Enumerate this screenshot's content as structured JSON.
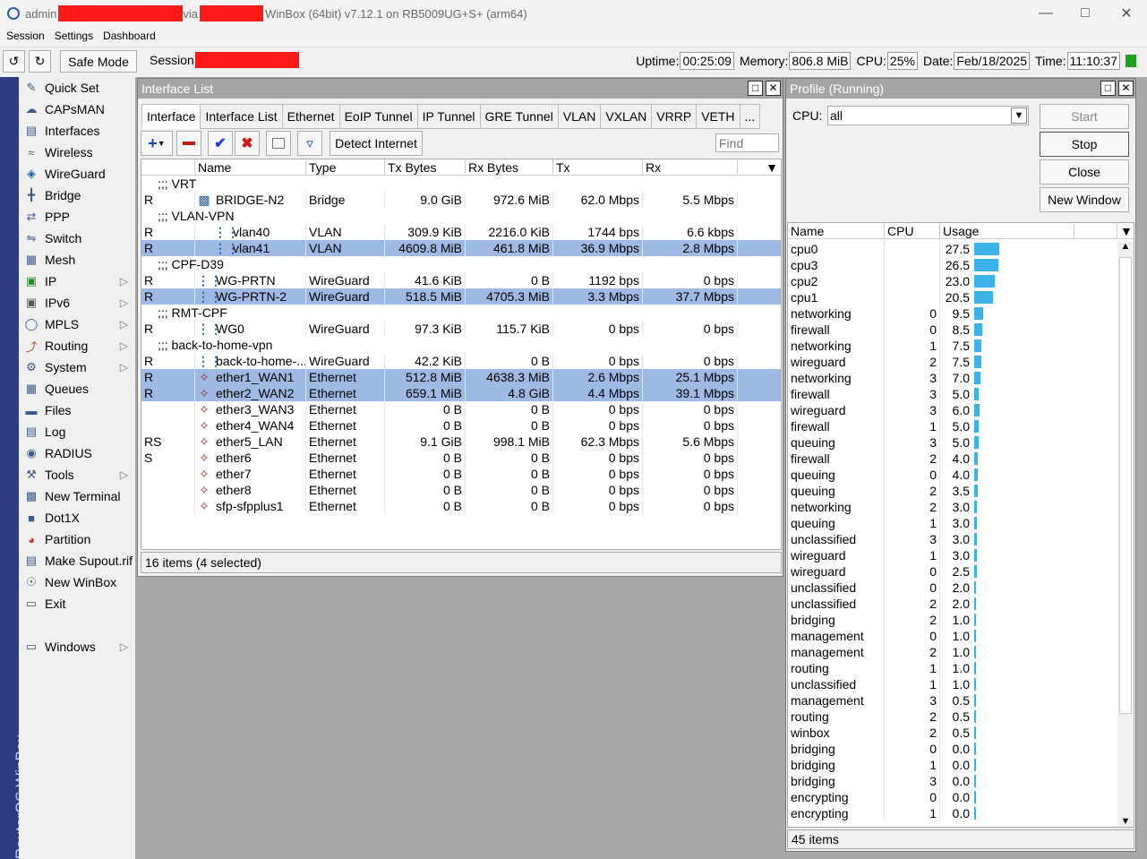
{
  "title": {
    "user": "admin",
    "via": "via",
    "app": "WinBox (64bit) v7.12.1 on RB5009UG+S+ (arm64)"
  },
  "menu": [
    "Session",
    "Settings",
    "Dashboard"
  ],
  "toolbar": {
    "safe_mode": "Safe Mode",
    "session_label": "Session:"
  },
  "status": {
    "uptime_label": "Uptime:",
    "uptime": "00:25:09",
    "memory_label": "Memory:",
    "memory": "806.8 MiB",
    "cpu_label": "CPU:",
    "cpu": "25%",
    "date_label": "Date:",
    "date": "Feb/18/2025",
    "time_label": "Time:",
    "time": "11:10:37"
  },
  "brand": "RouterOS WinBox",
  "sidebar": [
    {
      "label": "Quick Set",
      "icon": "wand-icon",
      "arrow": false
    },
    {
      "label": "CAPsMAN",
      "icon": "caps-icon",
      "arrow": false
    },
    {
      "label": "Interfaces",
      "icon": "interfaces-icon",
      "arrow": false
    },
    {
      "label": "Wireless",
      "icon": "wireless-icon",
      "arrow": false
    },
    {
      "label": "WireGuard",
      "icon": "wireguard-icon",
      "arrow": false
    },
    {
      "label": "Bridge",
      "icon": "bridge-icon",
      "arrow": false
    },
    {
      "label": "PPP",
      "icon": "ppp-icon",
      "arrow": false
    },
    {
      "label": "Switch",
      "icon": "switch-icon",
      "arrow": false
    },
    {
      "label": "Mesh",
      "icon": "mesh-icon",
      "arrow": false
    },
    {
      "label": "IP",
      "icon": "ip-icon",
      "arrow": true
    },
    {
      "label": "IPv6",
      "icon": "ipv6-icon",
      "arrow": true
    },
    {
      "label": "MPLS",
      "icon": "mpls-icon",
      "arrow": true
    },
    {
      "label": "Routing",
      "icon": "routing-icon",
      "arrow": true
    },
    {
      "label": "System",
      "icon": "system-icon",
      "arrow": true
    },
    {
      "label": "Queues",
      "icon": "queues-icon",
      "arrow": false
    },
    {
      "label": "Files",
      "icon": "files-icon",
      "arrow": false
    },
    {
      "label": "Log",
      "icon": "log-icon",
      "arrow": false
    },
    {
      "label": "RADIUS",
      "icon": "radius-icon",
      "arrow": false
    },
    {
      "label": "Tools",
      "icon": "tools-icon",
      "arrow": true
    },
    {
      "label": "New Terminal",
      "icon": "terminal-icon",
      "arrow": false
    },
    {
      "label": "Dot1X",
      "icon": "dot1x-icon",
      "arrow": false
    },
    {
      "label": "Partition",
      "icon": "partition-icon",
      "arrow": false
    },
    {
      "label": "Make Supout.rif",
      "icon": "supout-icon",
      "arrow": false
    },
    {
      "label": "New WinBox",
      "icon": "winbox-icon",
      "arrow": false
    },
    {
      "label": "Exit",
      "icon": "exit-icon",
      "arrow": false
    }
  ],
  "sidebar_windows": "Windows",
  "iface": {
    "title": "Interface List",
    "tabs": [
      "Interface",
      "Interface List",
      "Ethernet",
      "EoIP Tunnel",
      "IP Tunnel",
      "GRE Tunnel",
      "VLAN",
      "VXLAN",
      "VRRP",
      "VETH",
      "..."
    ],
    "detect": "Detect Internet",
    "find_placeholder": "Find",
    "columns": [
      "Name",
      "Type",
      "Tx Bytes",
      "Rx Bytes",
      "Tx",
      "Rx"
    ],
    "rows": [
      {
        "kind": "group",
        "text": ";;; VRT"
      },
      {
        "flag": "R",
        "name": "BRIDGE-N2",
        "type": "Bridge",
        "txb": "9.0 GiB",
        "rxb": "972.6 MiB",
        "tx": "62.0 Mbps",
        "rx": "5.5 Mbps",
        "icon": "bridge",
        "indent": 0,
        "sel": false
      },
      {
        "kind": "group",
        "text": ";;; VLAN-VPN"
      },
      {
        "flag": "R",
        "name": "vlan40",
        "type": "VLAN",
        "txb": "309.9 KiB",
        "rxb": "2216.0 KiB",
        "tx": "1744 bps",
        "rx": "6.6 kbps",
        "icon": "vlan",
        "indent": 1,
        "sel": false
      },
      {
        "flag": "R",
        "name": "vlan41",
        "type": "VLAN",
        "txb": "4609.8 MiB",
        "rxb": "461.8 MiB",
        "tx": "36.9 Mbps",
        "rx": "2.8 Mbps",
        "icon": "vlan",
        "indent": 1,
        "sel": true
      },
      {
        "kind": "group",
        "text": ";;; CPF-D39"
      },
      {
        "flag": "R",
        "name": "WG-PRTN",
        "type": "WireGuard",
        "txb": "41.6 KiB",
        "rxb": "0 B",
        "tx": "1192 bps",
        "rx": "0 bps",
        "icon": "wg",
        "indent": 0,
        "sel": false
      },
      {
        "flag": "R",
        "name": "WG-PRTN-2",
        "type": "WireGuard",
        "txb": "518.5 MiB",
        "rxb": "4705.3 MiB",
        "tx": "3.3 Mbps",
        "rx": "37.7 Mbps",
        "icon": "wg",
        "indent": 0,
        "sel": true
      },
      {
        "kind": "group",
        "text": ";;; RMT-CPF"
      },
      {
        "flag": "R",
        "name": "WG0",
        "type": "WireGuard",
        "txb": "97.3 KiB",
        "rxb": "115.7 KiB",
        "tx": "0 bps",
        "rx": "0 bps",
        "icon": "wg",
        "indent": 0,
        "sel": false
      },
      {
        "kind": "group",
        "text": ";;; back-to-home-vpn"
      },
      {
        "flag": "R",
        "name": "back-to-home-...",
        "type": "WireGuard",
        "txb": "42.2 KiB",
        "rxb": "0 B",
        "tx": "0 bps",
        "rx": "0 bps",
        "icon": "wg",
        "indent": 0,
        "sel": false
      },
      {
        "flag": "R",
        "name": "ether1_WAN1",
        "type": "Ethernet",
        "txb": "512.8 MiB",
        "rxb": "4638.3 MiB",
        "tx": "2.6 Mbps",
        "rx": "25.1 Mbps",
        "icon": "eth",
        "indent": 0,
        "sel": true
      },
      {
        "flag": "R",
        "name": "ether2_WAN2",
        "type": "Ethernet",
        "txb": "659.1 MiB",
        "rxb": "4.8 GiB",
        "tx": "4.4 Mbps",
        "rx": "39.1 Mbps",
        "icon": "eth",
        "indent": 0,
        "sel": true
      },
      {
        "flag": "",
        "name": "ether3_WAN3",
        "type": "Ethernet",
        "txb": "0 B",
        "rxb": "0 B",
        "tx": "0 bps",
        "rx": "0 bps",
        "icon": "eth",
        "indent": 0,
        "sel": false
      },
      {
        "flag": "",
        "name": "ether4_WAN4",
        "type": "Ethernet",
        "txb": "0 B",
        "rxb": "0 B",
        "tx": "0 bps",
        "rx": "0 bps",
        "icon": "eth",
        "indent": 0,
        "sel": false
      },
      {
        "flag": "RS",
        "name": "ether5_LAN",
        "type": "Ethernet",
        "txb": "9.1 GiB",
        "rxb": "998.1 MiB",
        "tx": "62.3 Mbps",
        "rx": "5.6 Mbps",
        "icon": "eth",
        "indent": 0,
        "sel": false
      },
      {
        "flag": "S",
        "name": "ether6",
        "type": "Ethernet",
        "txb": "0 B",
        "rxb": "0 B",
        "tx": "0 bps",
        "rx": "0 bps",
        "icon": "eth",
        "indent": 0,
        "sel": false
      },
      {
        "flag": "",
        "name": "ether7",
        "type": "Ethernet",
        "txb": "0 B",
        "rxb": "0 B",
        "tx": "0 bps",
        "rx": "0 bps",
        "icon": "eth",
        "indent": 0,
        "sel": false
      },
      {
        "flag": "",
        "name": "ether8",
        "type": "Ethernet",
        "txb": "0 B",
        "rxb": "0 B",
        "tx": "0 bps",
        "rx": "0 bps",
        "icon": "eth",
        "indent": 0,
        "sel": false
      },
      {
        "flag": "",
        "name": "sfp-sfpplus1",
        "type": "Ethernet",
        "txb": "0 B",
        "rxb": "0 B",
        "tx": "0 bps",
        "rx": "0 bps",
        "icon": "eth",
        "indent": 0,
        "sel": false
      }
    ],
    "footer": "16 items (4 selected)"
  },
  "profile": {
    "title": "Profile (Running)",
    "cpu_label": "CPU:",
    "cpu_value": "all",
    "buttons": [
      "Start",
      "Stop",
      "Close",
      "New Window"
    ],
    "columns": [
      "Name",
      "CPU",
      "Usage"
    ],
    "rows": [
      [
        "cpu0",
        "",
        "27.5"
      ],
      [
        "cpu3",
        "",
        "26.5"
      ],
      [
        "cpu2",
        "",
        "23.0"
      ],
      [
        "cpu1",
        "",
        "20.5"
      ],
      [
        "networking",
        "0",
        "9.5"
      ],
      [
        "firewall",
        "0",
        "8.5"
      ],
      [
        "networking",
        "1",
        "7.5"
      ],
      [
        "wireguard",
        "2",
        "7.5"
      ],
      [
        "networking",
        "3",
        "7.0"
      ],
      [
        "firewall",
        "3",
        "5.0"
      ],
      [
        "wireguard",
        "3",
        "6.0"
      ],
      [
        "firewall",
        "1",
        "5.0"
      ],
      [
        "queuing",
        "3",
        "5.0"
      ],
      [
        "firewall",
        "2",
        "4.0"
      ],
      [
        "queuing",
        "0",
        "4.0"
      ],
      [
        "queuing",
        "2",
        "3.5"
      ],
      [
        "networking",
        "2",
        "3.0"
      ],
      [
        "queuing",
        "1",
        "3.0"
      ],
      [
        "unclassified",
        "3",
        "3.0"
      ],
      [
        "wireguard",
        "1",
        "3.0"
      ],
      [
        "wireguard",
        "0",
        "2.5"
      ],
      [
        "unclassified",
        "0",
        "2.0"
      ],
      [
        "unclassified",
        "2",
        "2.0"
      ],
      [
        "bridging",
        "2",
        "1.0"
      ],
      [
        "management",
        "0",
        "1.0"
      ],
      [
        "management",
        "2",
        "1.0"
      ],
      [
        "routing",
        "1",
        "1.0"
      ],
      [
        "unclassified",
        "1",
        "1.0"
      ],
      [
        "management",
        "3",
        "0.5"
      ],
      [
        "routing",
        "2",
        "0.5"
      ],
      [
        "winbox",
        "2",
        "0.5"
      ],
      [
        "bridging",
        "0",
        "0.0"
      ],
      [
        "bridging",
        "1",
        "0.0"
      ],
      [
        "bridging",
        "3",
        "0.0"
      ],
      [
        "encrypting",
        "0",
        "0.0"
      ],
      [
        "encrypting",
        "1",
        "0.0"
      ]
    ],
    "footer": "45 items"
  }
}
